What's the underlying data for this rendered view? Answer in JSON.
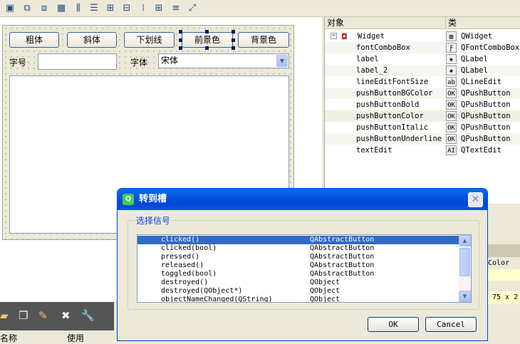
{
  "toolbar": {
    "icons": [
      "edit-widgets-icon",
      "edit-signals-icon",
      "edit-buddies-icon",
      "tab-order-icon",
      "layout-horizontal-icon",
      "layout-vertical-icon",
      "layout-hsplitter-icon",
      "layout-vsplitter-icon",
      "layout-form-icon",
      "layout-grid-icon",
      "break-layout-icon",
      "adjust-size-icon"
    ]
  },
  "form": {
    "buttons": [
      "粗体",
      "斜体",
      "下划线",
      "前景色",
      "背景色"
    ],
    "font_size_label": "字号",
    "font_label": "字体",
    "font_combo_value": "宋体"
  },
  "inspector": {
    "header": {
      "object": "对象",
      "class": "类"
    },
    "rows": [
      {
        "name": "Widget",
        "cls": "QWidget",
        "icon": "widget-icon"
      },
      {
        "name": "fontComboBox",
        "cls": "QFontComboBox",
        "icon": "font-combobox-icon"
      },
      {
        "name": "label",
        "cls": "QLabel",
        "icon": "label-icon"
      },
      {
        "name": "label_2",
        "cls": "QLabel",
        "icon": "label-icon"
      },
      {
        "name": "lineEditFontSize",
        "cls": "QLineEdit",
        "icon": "lineedit-icon"
      },
      {
        "name": "pushButtonBGColor",
        "cls": "QPushButton",
        "icon": "pushbutton-icon"
      },
      {
        "name": "pushButtonBold",
        "cls": "QPushButton",
        "icon": "pushbutton-icon"
      },
      {
        "name": "pushButtonColor",
        "cls": "QPushButton",
        "icon": "pushbutton-icon"
      },
      {
        "name": "pushButtonItalic",
        "cls": "QPushButton",
        "icon": "pushbutton-icon"
      },
      {
        "name": "pushButtonUnderline",
        "cls": "QPushButton",
        "icon": "pushbutton-icon"
      },
      {
        "name": "textEdit",
        "cls": "QTextEdit",
        "icon": "textedit-icon"
      }
    ]
  },
  "property_partial": {
    "color_text": "Color",
    "size_text": "75 x 2"
  },
  "bottom_panel": {
    "col_name": "名称",
    "col_use": "使用"
  },
  "dialog": {
    "title": "转到槽",
    "group_title": "选择信号",
    "signals": [
      {
        "sig": "clicked()",
        "cls": "QAbstractButton"
      },
      {
        "sig": "clicked(bool)",
        "cls": "QAbstractButton"
      },
      {
        "sig": "pressed()",
        "cls": "QAbstractButton"
      },
      {
        "sig": "released()",
        "cls": "QAbstractButton"
      },
      {
        "sig": "toggled(bool)",
        "cls": "QAbstractButton"
      },
      {
        "sig": "destroyed()",
        "cls": "QObject"
      },
      {
        "sig": "destroyed(QObject*)",
        "cls": "QObject"
      },
      {
        "sig": "objectNameChanged(QString)",
        "cls": "QObject"
      }
    ],
    "ok_label": "OK",
    "cancel_label": "Cancel"
  },
  "colors": {
    "title_bar": "#0a5ee8",
    "selection": "#316ac5",
    "group_title": "#0046d5"
  }
}
